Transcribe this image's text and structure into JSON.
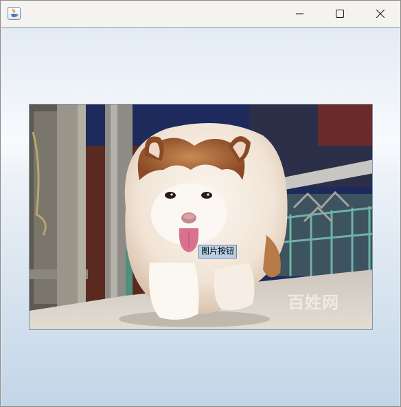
{
  "window": {
    "title": "",
    "icon": "java-cup-icon",
    "controls": {
      "minimize_icon": "minimize-icon",
      "maximize_icon": "maximize-icon",
      "close_icon": "close-icon"
    }
  },
  "content": {
    "image_button": {
      "label": "图片按钮",
      "photo": "fluffy-puppy-photo",
      "watermark": "百姓网"
    }
  }
}
